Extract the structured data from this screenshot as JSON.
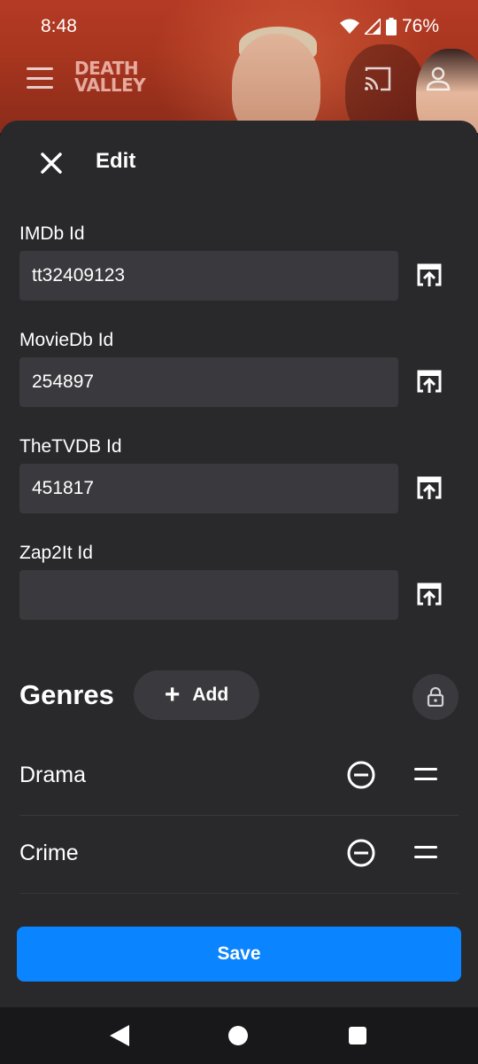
{
  "status": {
    "time": "8:48",
    "battery": "76%"
  },
  "app": {
    "logo_line1": "DEATH",
    "logo_line2": "VALLEY"
  },
  "sheet": {
    "title": "Edit",
    "fields": [
      {
        "label": "IMDb Id",
        "value": "tt32409123",
        "placeholder": ""
      },
      {
        "label": "MovieDb Id",
        "value": "254897",
        "placeholder": ""
      },
      {
        "label": "TheTVDB Id",
        "value": "451817",
        "placeholder": ""
      },
      {
        "label": "Zap2It Id",
        "value": "",
        "placeholder": ""
      }
    ],
    "genres": {
      "title": "Genres",
      "add_label": "Add",
      "items": [
        {
          "name": "Drama"
        },
        {
          "name": "Crime"
        }
      ]
    },
    "save_label": "Save"
  },
  "colors": {
    "accent": "#0a84ff",
    "sheet_bg": "#29292b",
    "input_bg": "#3a3a3e"
  },
  "icons": {
    "close": "close-icon",
    "open_external": "open-in-new-icon",
    "lock": "lock-icon",
    "remove": "remove-circle-icon",
    "drag": "drag-handle-icon",
    "cast": "cast-icon",
    "account": "account-icon",
    "menu": "menu-icon"
  }
}
